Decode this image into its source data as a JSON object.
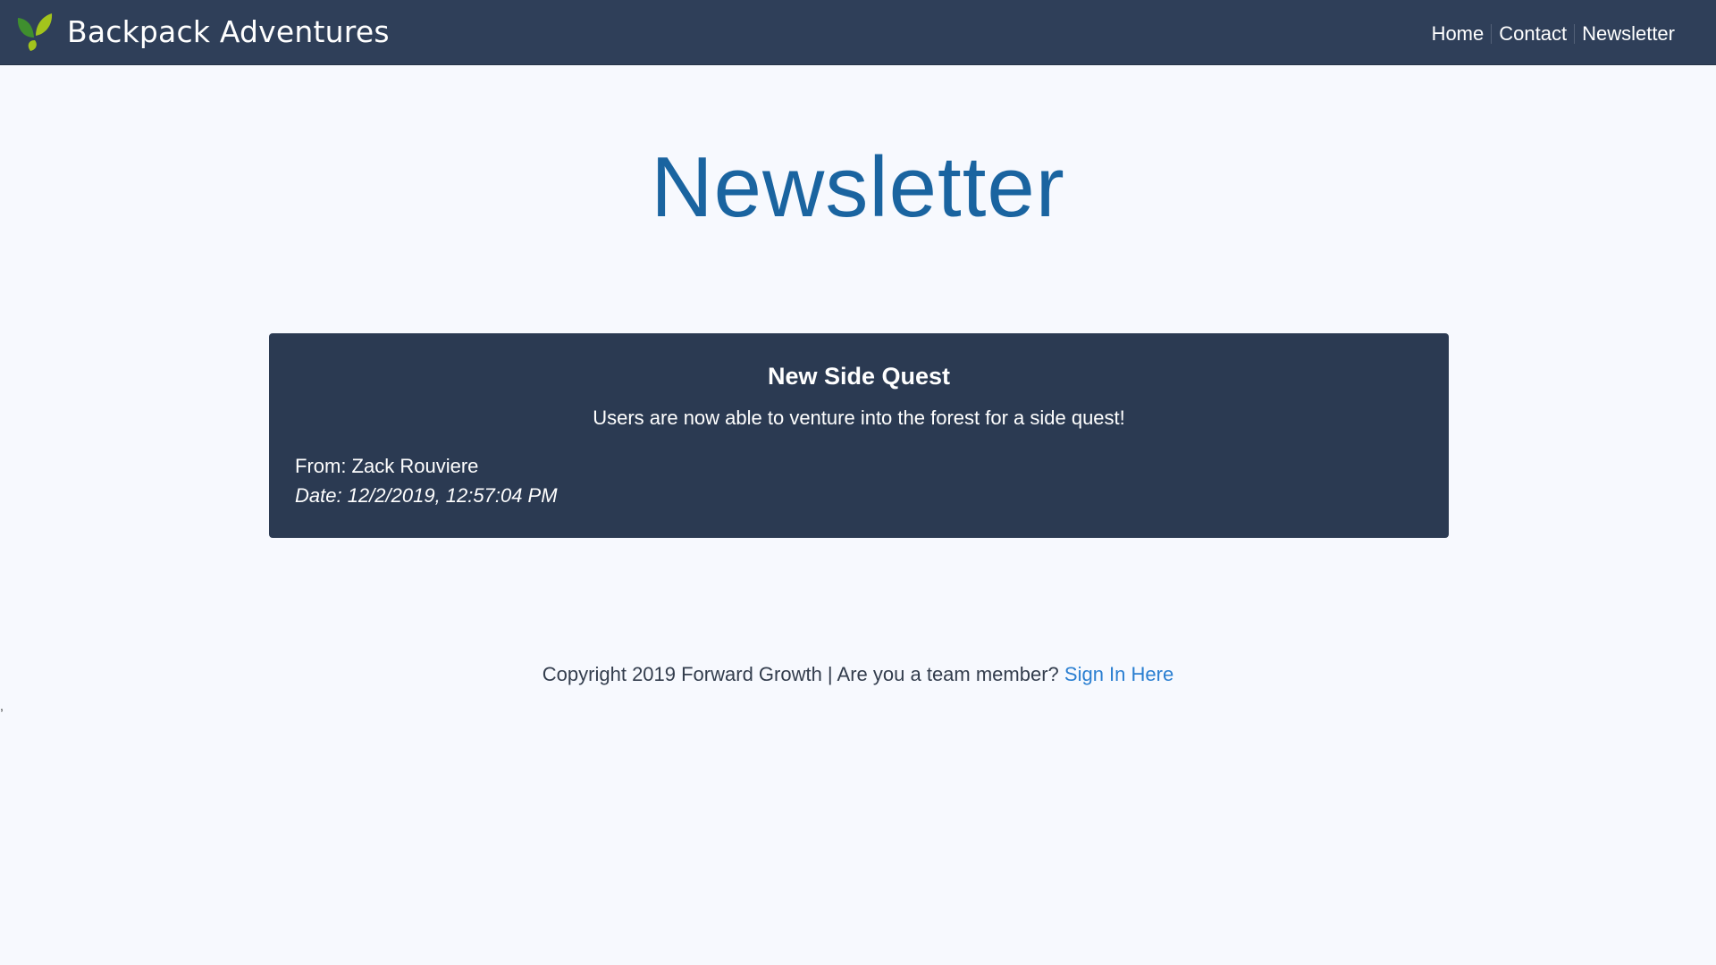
{
  "header": {
    "brand_title": "Backpack Adventures",
    "logo_icon": "leaf-logo-icon",
    "nav": [
      {
        "label": "Home"
      },
      {
        "label": "Contact"
      },
      {
        "label": "Newsletter"
      }
    ]
  },
  "main": {
    "page_title": "Newsletter",
    "newsletter_card": {
      "title": "New Side Quest",
      "body": "Users are now able to venture into the forest for a side quest!",
      "from": "From: Zack Rouviere",
      "date": "Date: 12/2/2019, 12:57:04 PM"
    }
  },
  "footer": {
    "copyright_text": "Copyright 2019 Forward Growth | Are you a team member?",
    "sign_in_link": "Sign In Here"
  },
  "stray_text": ",",
  "colors": {
    "navbar_bg": "#2f3f59",
    "page_bg": "#f7f9fe",
    "title_blue": "#1a64a0",
    "card_bg": "#2b3a52",
    "link_blue": "#2b7fd1",
    "leaf_dark_green": "#3f8f2e",
    "leaf_light_green": "#a3c41c"
  }
}
